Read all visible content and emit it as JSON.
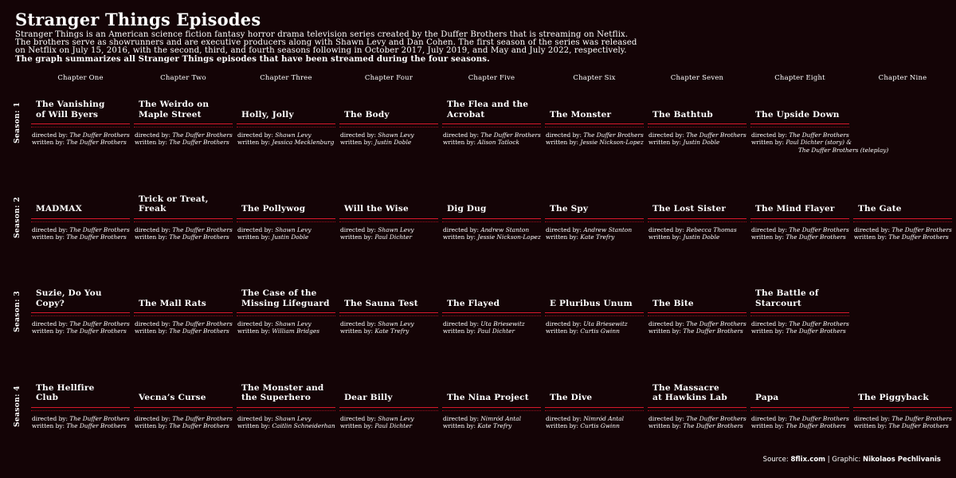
{
  "title": "Stranger Things Episodes",
  "subtitle_lines": [
    "Stranger Things is an American science fiction fantasy horror drama television series created by the Duffer Brothers that is streaming on Netflix.",
    "The brothers serve as showrunners and are executive producers along with Shawn Levy and Dan Cohen. The first season of the series was released",
    "on Netflix on July 15, 2016, with the second, third, and fourth seasons following in October 2017, July 2019, and May and July 2022, respectively."
  ],
  "subtitle_bold": "The graph summarizes all Stranger Things episodes that have been streamed during the four seasons.",
  "footer": {
    "source_label": "Source:",
    "source_value": "8flix.com",
    "separator": "|",
    "graphic_label": "Graphic:",
    "graphic_value": "Nikolaos Pechlivanis"
  },
  "chart_data": {
    "type": "table",
    "columns": [
      "Chapter One",
      "Chapter Two",
      "Chapter Three",
      "Chapter Four",
      "Chapter Five",
      "Chapter Six",
      "Chapter Seven",
      "Chapter Eight",
      "Chapter Nine"
    ],
    "credit_labels": {
      "directed": "directed by:",
      "written": "written by:"
    },
    "seasons": [
      {
        "label": "Season: 1",
        "episodes": [
          {
            "title": "The Vanishing of Will Byers",
            "lines": [
              "The Vanishing",
              "of Will Byers"
            ],
            "directed_by": "The Duffer Brothers",
            "written_by": [
              "The Duffer Brothers"
            ]
          },
          {
            "title": "The Weirdo on Maple Street",
            "lines": [
              "The Weirdo on",
              "Maple Street"
            ],
            "directed_by": "The Duffer Brothers",
            "written_by": [
              "The Duffer Brothers"
            ]
          },
          {
            "title": "Holly, Jolly",
            "lines": [
              "Holly, Jolly"
            ],
            "directed_by": "Shawn Levy",
            "written_by": [
              "Jessica Mecklenburg"
            ]
          },
          {
            "title": "The Body",
            "lines": [
              "The Body"
            ],
            "directed_by": "Shawn Levy",
            "written_by": [
              "Justin Doble"
            ]
          },
          {
            "title": "The Flea and the Acrobat",
            "lines": [
              "The Flea and the",
              "Acrobat"
            ],
            "directed_by": "The Duffer Brothers",
            "written_by": [
              "Alison Tatlock"
            ]
          },
          {
            "title": "The Monster",
            "lines": [
              "The Monster"
            ],
            "directed_by": "The Duffer Brothers",
            "written_by": [
              "Jessie Nickson-Lopez"
            ]
          },
          {
            "title": "The Bathtub",
            "lines": [
              "The Bathtub"
            ],
            "directed_by": "The Duffer Brothers",
            "written_by": [
              "Justin Doble"
            ]
          },
          {
            "title": "The Upside Down",
            "lines": [
              "The Upside Down"
            ],
            "directed_by": "The Duffer Brothers",
            "written_by": [
              "Paul Dichter (story) &",
              "The Duffer Brothers (teleplay)"
            ]
          }
        ]
      },
      {
        "label": "Season: 2",
        "episodes": [
          {
            "title": "MADMAX",
            "lines": [
              "MADMAX"
            ],
            "directed_by": "The Duffer Brothers",
            "written_by": [
              "The Duffer Brothers"
            ]
          },
          {
            "title": "Trick or Treat, Freak",
            "lines": [
              "Trick or Treat,",
              "Freak"
            ],
            "directed_by": "The Duffer Brothers",
            "written_by": [
              "The Duffer Brothers"
            ]
          },
          {
            "title": "The Pollywog",
            "lines": [
              "The Pollywog"
            ],
            "directed_by": "Shawn Levy",
            "written_by": [
              "Justin Doble"
            ]
          },
          {
            "title": "Will the Wise",
            "lines": [
              "Will the Wise"
            ],
            "directed_by": "Shawn Levy",
            "written_by": [
              "Paul Dichter"
            ]
          },
          {
            "title": "Dig Dug",
            "lines": [
              "Dig Dug"
            ],
            "directed_by": "Andrew Stanton",
            "written_by": [
              "Jessie Nickson-Lopez"
            ]
          },
          {
            "title": "The Spy",
            "lines": [
              "The Spy"
            ],
            "directed_by": "Andrew Stanton",
            "written_by": [
              "Kate Trefry"
            ]
          },
          {
            "title": "The Lost Sister",
            "lines": [
              "The Lost Sister"
            ],
            "directed_by": "Rebecca Thomas",
            "written_by": [
              "Justin Doble"
            ]
          },
          {
            "title": "The Mind Flayer",
            "lines": [
              "The Mind Flayer"
            ],
            "directed_by": "The Duffer Brothers",
            "written_by": [
              "The Duffer Brothers"
            ]
          },
          {
            "title": "The Gate",
            "lines": [
              "The Gate"
            ],
            "directed_by": "The Duffer Brothers",
            "written_by": [
              "The Duffer Brothers"
            ]
          }
        ]
      },
      {
        "label": "Season: 3",
        "episodes": [
          {
            "title": "Suzie, Do You Copy?",
            "lines": [
              "Suzie, Do You",
              "Copy?"
            ],
            "directed_by": "The Duffer Brothers",
            "written_by": [
              "The Duffer Brothers"
            ]
          },
          {
            "title": "The Mall Rats",
            "lines": [
              "The Mall Rats"
            ],
            "directed_by": "The Duffer Brothers",
            "written_by": [
              "The Duffer Brothers"
            ]
          },
          {
            "title": "The Case of the Missing Lifeguard",
            "lines": [
              "The Case of the",
              "Missing Lifeguard"
            ],
            "directed_by": "Shawn Levy",
            "written_by": [
              "William Bridges"
            ]
          },
          {
            "title": "The Sauna Test",
            "lines": [
              "The Sauna Test"
            ],
            "directed_by": "Shawn Levy",
            "written_by": [
              "Kate Trefry"
            ]
          },
          {
            "title": "The Flayed",
            "lines": [
              "The Flayed"
            ],
            "directed_by": "Uta Briesewitz",
            "written_by": [
              "Paul Dichter"
            ]
          },
          {
            "title": "E Pluribus Unum",
            "lines": [
              "E Pluribus Unum"
            ],
            "directed_by": "Uta Briesewitz",
            "written_by": [
              "Curtis Gwinn"
            ]
          },
          {
            "title": "The Bite",
            "lines": [
              "The Bite"
            ],
            "directed_by": "The Duffer Brothers",
            "written_by": [
              "The Duffer Brothers"
            ]
          },
          {
            "title": "The Battle of Starcourt",
            "lines": [
              "The Battle of",
              "Starcourt"
            ],
            "directed_by": "The Duffer Brothers",
            "written_by": [
              "The Duffer Brothers"
            ]
          }
        ]
      },
      {
        "label": "Season: 4",
        "episodes": [
          {
            "title": "The Hellfire Club",
            "lines": [
              "The Hellfire",
              "Club"
            ],
            "directed_by": "The Duffer Brothers",
            "written_by": [
              "The Duffer Brothers"
            ]
          },
          {
            "title": "Vecna's Curse",
            "lines": [
              "Vecna’s Curse"
            ],
            "directed_by": "The Duffer Brothers",
            "written_by": [
              "The Duffer Brothers"
            ]
          },
          {
            "title": "The Monster and the Superhero",
            "lines": [
              "The Monster and",
              "the Superhero"
            ],
            "directed_by": "Shawn Levy",
            "written_by": [
              "Caitlin Schneiderhan"
            ]
          },
          {
            "title": "Dear Billy",
            "lines": [
              "Dear Billy"
            ],
            "directed_by": "Shawn Levy",
            "written_by": [
              "Paul Dichter"
            ]
          },
          {
            "title": "The Nina Project",
            "lines": [
              "The Nina Project"
            ],
            "directed_by": "Nimród Antal",
            "written_by": [
              "Kate Trefry"
            ]
          },
          {
            "title": "The Dive",
            "lines": [
              "The Dive"
            ],
            "directed_by": "Nimród Antal",
            "written_by": [
              "Curtis Gwinn"
            ]
          },
          {
            "title": "The Massacre at Hawkins Lab",
            "lines": [
              "The Massacre",
              "at Hawkins Lab"
            ],
            "directed_by": "The Duffer Brothers",
            "written_by": [
              "The Duffer Brothers"
            ]
          },
          {
            "title": "Papa",
            "lines": [
              "Papa"
            ],
            "directed_by": "The Duffer Brothers",
            "written_by": [
              "The Duffer Brothers"
            ]
          },
          {
            "title": "The Piggyback",
            "lines": [
              "The Piggyback"
            ],
            "directed_by": "The Duffer Brothers",
            "written_by": [
              "The Duffer Brothers"
            ]
          }
        ]
      }
    ]
  }
}
